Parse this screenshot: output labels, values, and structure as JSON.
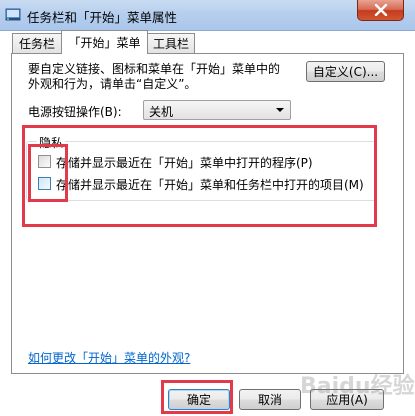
{
  "window": {
    "title": "任务栏和「开始」菜单属性",
    "close_icon": "close-icon"
  },
  "tabs": [
    {
      "label": "任务栏",
      "active": false
    },
    {
      "label": "「开始」菜单",
      "active": true
    },
    {
      "label": "工具栏",
      "active": false
    }
  ],
  "start_menu": {
    "description": "要自定义链接、图标和菜单在「开始」菜单中的\n外观和行为，请单击“自定义”。",
    "customize_button": "自定义(C)...",
    "power_button_label": "电源按钮操作(B):",
    "power_button_value": "关机",
    "privacy": {
      "legend": "隐私",
      "options": [
        {
          "label": "存储并显示最近在「开始」菜单中打开的程序(P)",
          "checked": false
        },
        {
          "label": "存储并显示最近在「开始」菜单和任务栏中打开的项目(M)",
          "checked": false
        }
      ]
    },
    "help_link": "如何更改「开始」菜单的外观?"
  },
  "buttons": {
    "ok": "确定",
    "cancel": "取消",
    "apply": "应用(A)"
  },
  "watermark": "Baidu经验",
  "colors": {
    "annotation_red": "#e23a4b",
    "link_blue": "#0066cc",
    "close_red": "#c43b1d"
  }
}
